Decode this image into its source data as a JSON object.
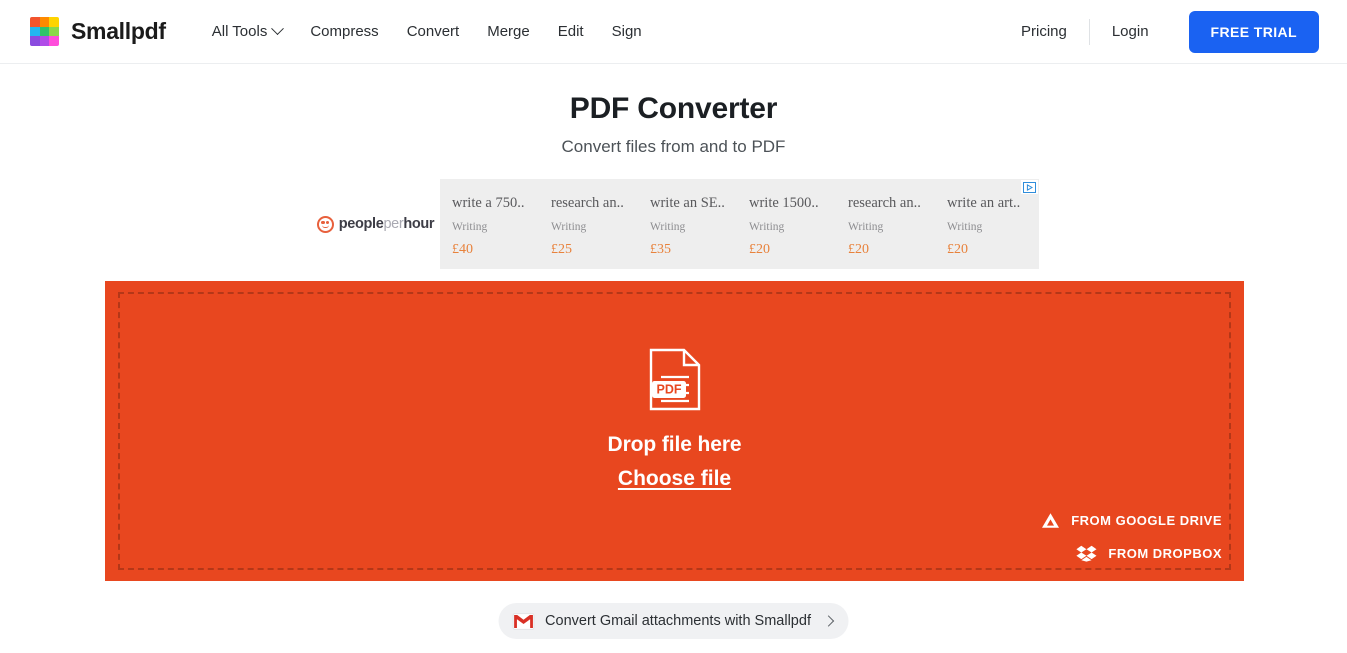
{
  "header": {
    "brand_name": "Smallpdf",
    "logo_icon": "smallpdf-logo-grid",
    "logo_colors": [
      "#f2542d",
      "#ff8a00",
      "#ffd400",
      "#22b6f0",
      "#2fc46b",
      "#8cd84a",
      "#8a4bdf",
      "#b04ce8",
      "#ff4ddb"
    ],
    "nav": [
      {
        "label": "All Tools",
        "has_chevron": true,
        "icon": "chevron-down-icon"
      },
      {
        "label": "Compress",
        "has_chevron": false
      },
      {
        "label": "Convert",
        "has_chevron": false
      },
      {
        "label": "Merge",
        "has_chevron": false
      },
      {
        "label": "Edit",
        "has_chevron": false
      },
      {
        "label": "Sign",
        "has_chevron": false
      }
    ],
    "pricing_label": "Pricing",
    "login_label": "Login",
    "trial_label": "FREE TRIAL",
    "trial_color": "#1a62f2"
  },
  "main": {
    "title": "PDF Converter",
    "subtitle": "Convert files from and to PDF"
  },
  "ad": {
    "advertiser": "peopleperhour",
    "advertiser_part_bold_1": "people",
    "advertiser_part_grey": "per",
    "advertiser_part_bold_2": "hour",
    "logo_icon": "pph-smiley-icon",
    "adchoices_icon": "adchoices-icon",
    "items": [
      {
        "title": "write a 750..",
        "category": "Writing",
        "price": "£40"
      },
      {
        "title": "research an..",
        "category": "Writing",
        "price": "£25"
      },
      {
        "title": "write an SE..",
        "category": "Writing",
        "price": "£35"
      },
      {
        "title": "write 1500..",
        "category": "Writing",
        "price": "£20"
      },
      {
        "title": "research an..",
        "category": "Writing",
        "price": "£20"
      },
      {
        "title": "write an art..",
        "category": "Writing",
        "price": "£20"
      }
    ],
    "price_color": "#e8823c"
  },
  "dropzone": {
    "background_color": "#e8471f",
    "file_icon": "pdf-file-icon",
    "file_icon_label": "PDF",
    "drop_text": "Drop file here",
    "choose_text": "Choose file",
    "cloud_options": [
      {
        "label": "FROM GOOGLE DRIVE",
        "icon": "google-drive-icon"
      },
      {
        "label": "FROM DROPBOX",
        "icon": "dropbox-icon"
      }
    ]
  },
  "gmail": {
    "icon": "gmail-icon",
    "label": "Convert Gmail attachments with Smallpdf",
    "chevron_icon": "chevron-right-icon"
  }
}
